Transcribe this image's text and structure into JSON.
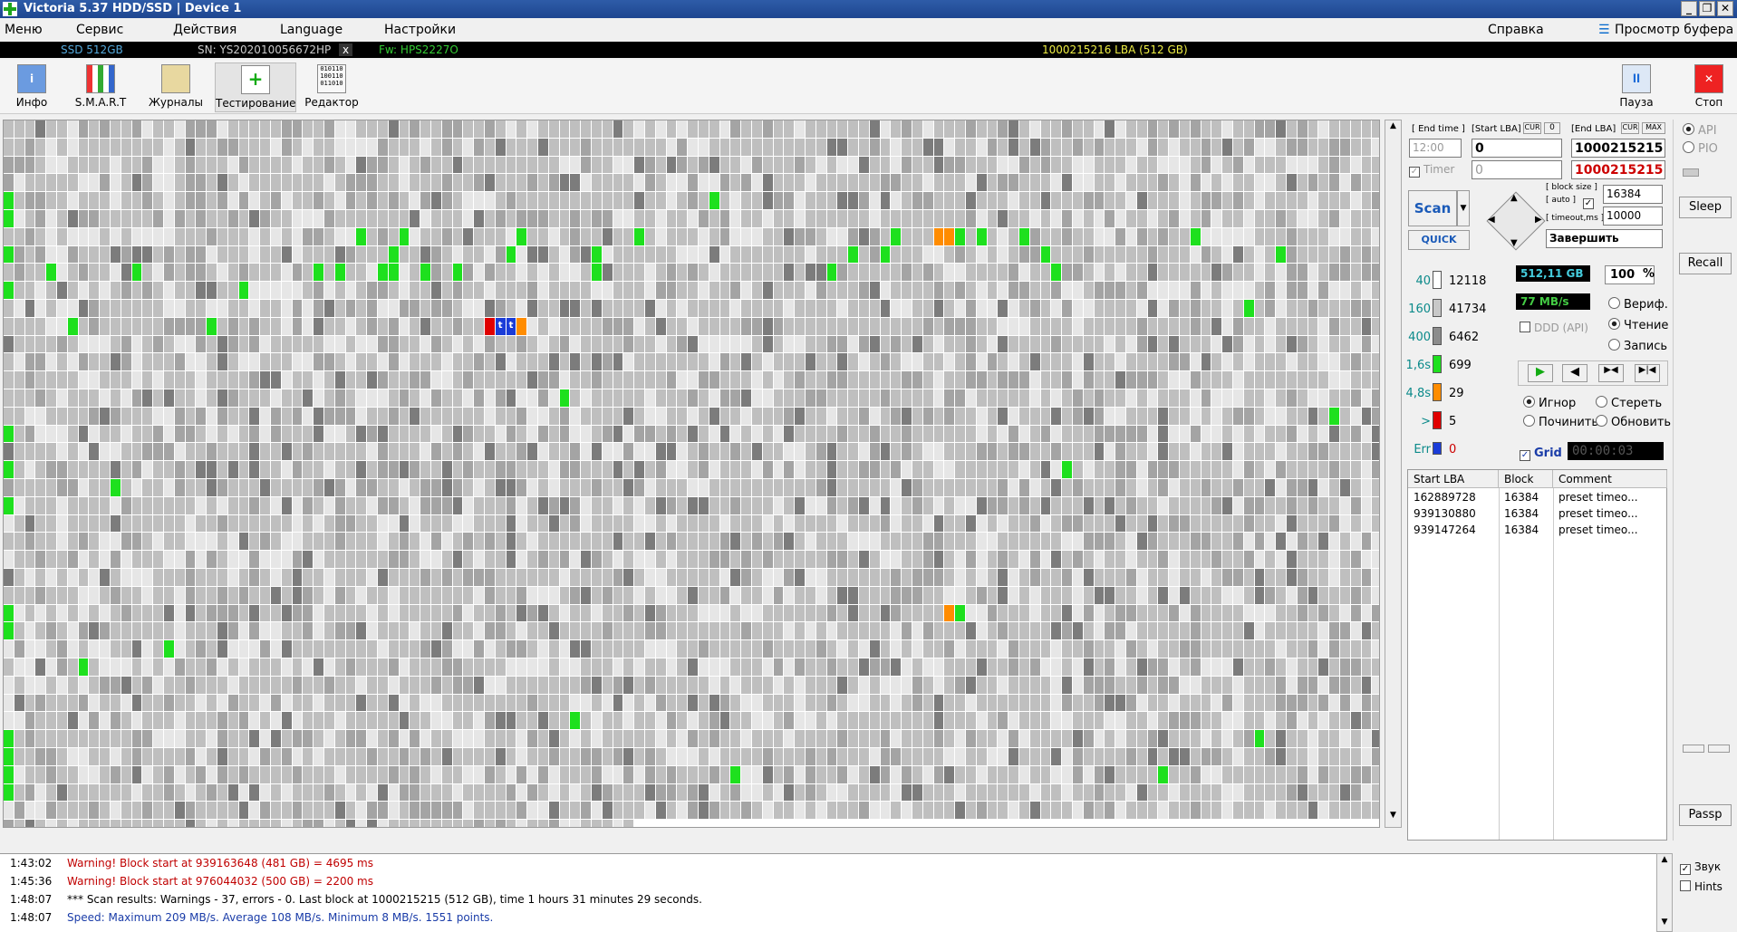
{
  "window": {
    "title": "Victoria 5.37 HDD/SSD | Device 1",
    "min": "_",
    "max": "❐",
    "close": "✕"
  },
  "menu": {
    "items": [
      "Меню",
      "Сервис",
      "Действия",
      "Language",
      "Настройки"
    ],
    "help": "Справка",
    "buffer": "Просмотр буфера"
  },
  "info": {
    "model": "SSD 512GB",
    "sn": "SN: YS202010056672HP",
    "x": "x",
    "fw": "Fw: HPS2227O",
    "lba": "1000215216 LBA (512 GB)"
  },
  "toolbar": {
    "info": "Инфо",
    "smart": "S.M.A.R.T",
    "logs": "Журналы",
    "test": "Тестирование",
    "editor": "Редактор",
    "pause": "Пауза",
    "stop": "Стоп"
  },
  "grid": {
    "rows": 40,
    "cols": 129,
    "last_row_filled": 59,
    "highlights": [
      {
        "r": 4,
        "c": 0,
        "k": "g"
      },
      {
        "r": 4,
        "c": 66,
        "k": "g"
      },
      {
        "r": 5,
        "c": 0,
        "k": "g"
      },
      {
        "r": 6,
        "c": 33,
        "k": "g"
      },
      {
        "r": 6,
        "c": 37,
        "k": "g"
      },
      {
        "r": 6,
        "c": 48,
        "k": "g"
      },
      {
        "r": 6,
        "c": 59,
        "k": "g"
      },
      {
        "r": 6,
        "c": 83,
        "k": "g"
      },
      {
        "r": 6,
        "c": 87,
        "k": "o"
      },
      {
        "r": 6,
        "c": 88,
        "k": "o"
      },
      {
        "r": 6,
        "c": 89,
        "k": "g"
      },
      {
        "r": 6,
        "c": 91,
        "k": "g"
      },
      {
        "r": 6,
        "c": 95,
        "k": "g"
      },
      {
        "r": 6,
        "c": 111,
        "k": "g"
      },
      {
        "r": 7,
        "c": 0,
        "k": "g"
      },
      {
        "r": 7,
        "c": 36,
        "k": "g"
      },
      {
        "r": 7,
        "c": 47,
        "k": "g"
      },
      {
        "r": 7,
        "c": 55,
        "k": "g"
      },
      {
        "r": 7,
        "c": 79,
        "k": "g"
      },
      {
        "r": 7,
        "c": 82,
        "k": "g"
      },
      {
        "r": 7,
        "c": 97,
        "k": "g"
      },
      {
        "r": 7,
        "c": 119,
        "k": "g"
      },
      {
        "r": 8,
        "c": 4,
        "k": "g"
      },
      {
        "r": 8,
        "c": 12,
        "k": "g"
      },
      {
        "r": 8,
        "c": 29,
        "k": "g"
      },
      {
        "r": 8,
        "c": 31,
        "k": "g"
      },
      {
        "r": 8,
        "c": 35,
        "k": "g"
      },
      {
        "r": 8,
        "c": 36,
        "k": "g"
      },
      {
        "r": 8,
        "c": 39,
        "k": "g"
      },
      {
        "r": 8,
        "c": 42,
        "k": "g"
      },
      {
        "r": 8,
        "c": 55,
        "k": "g"
      },
      {
        "r": 8,
        "c": 77,
        "k": "g"
      },
      {
        "r": 8,
        "c": 98,
        "k": "g"
      },
      {
        "r": 9,
        "c": 0,
        "k": "g"
      },
      {
        "r": 9,
        "c": 22,
        "k": "g"
      },
      {
        "r": 10,
        "c": 116,
        "k": "g"
      },
      {
        "r": 11,
        "c": 6,
        "k": "g"
      },
      {
        "r": 11,
        "c": 19,
        "k": "g"
      },
      {
        "r": 11,
        "c": 45,
        "k": "r"
      },
      {
        "r": 11,
        "c": 46,
        "k": "b"
      },
      {
        "r": 11,
        "c": 47,
        "k": "b"
      },
      {
        "r": 11,
        "c": 48,
        "k": "o"
      },
      {
        "r": 15,
        "c": 52,
        "k": "g"
      },
      {
        "r": 16,
        "c": 124,
        "k": "g"
      },
      {
        "r": 17,
        "c": 0,
        "k": "g"
      },
      {
        "r": 19,
        "c": 0,
        "k": "g"
      },
      {
        "r": 19,
        "c": 99,
        "k": "g"
      },
      {
        "r": 20,
        "c": 10,
        "k": "g"
      },
      {
        "r": 21,
        "c": 0,
        "k": "g"
      },
      {
        "r": 27,
        "c": 0,
        "k": "g"
      },
      {
        "r": 27,
        "c": 88,
        "k": "o"
      },
      {
        "r": 27,
        "c": 89,
        "k": "g"
      },
      {
        "r": 28,
        "c": 0,
        "k": "g"
      },
      {
        "r": 29,
        "c": 15,
        "k": "g"
      },
      {
        "r": 30,
        "c": 7,
        "k": "g"
      },
      {
        "r": 33,
        "c": 53,
        "k": "g"
      },
      {
        "r": 34,
        "c": 0,
        "k": "g"
      },
      {
        "r": 34,
        "c": 117,
        "k": "g"
      },
      {
        "r": 35,
        "c": 0,
        "k": "g"
      },
      {
        "r": 36,
        "c": 0,
        "k": "g"
      },
      {
        "r": 36,
        "c": 68,
        "k": "g"
      },
      {
        "r": 36,
        "c": 108,
        "k": "g"
      },
      {
        "r": 37,
        "c": 0,
        "k": "g"
      }
    ]
  },
  "controls": {
    "end_time_label": "[ End time ]",
    "start_lba_label": "[Start LBA]",
    "cur": "CUR",
    "zero": "0",
    "end_lba_label": "[End LBA]",
    "cur2": "CUR",
    "max": "MAX",
    "time": "12:00",
    "start_lba": "0",
    "end_lba": "1000215215",
    "timer": "Timer",
    "timer_val": "0",
    "end_lba2": "1000215215",
    "scan": "Scan",
    "quick": "QUICK",
    "block_size_label": "[ block size ]",
    "auto_label": "[ auto ]",
    "timeout_label": "[ timeout,ms ]",
    "block_size": "16384",
    "timeout": "10000",
    "finish": "Завершить"
  },
  "legend": [
    {
      "k": "40",
      "v": "12118",
      "c": "#ffffff"
    },
    {
      "k": "160",
      "v": "41734",
      "c": "#c8c8c8"
    },
    {
      "k": "400",
      "v": "6462",
      "c": "#8c8c8c"
    },
    {
      "k": "1,6s",
      "v": "699",
      "c": "#1ee01e"
    },
    {
      "k": "4,8s",
      "v": "29",
      "c": "#ff8c00"
    },
    {
      "k": ">",
      "v": "5",
      "c": "#e00000"
    },
    {
      "k": "Err",
      "v": "0",
      "c": "#1a3cd8"
    }
  ],
  "stats": {
    "size": "512,11 GB",
    "pct": "100",
    "pct_unit": "%",
    "speed": "77 MB/s",
    "ddd": "DDD (API)",
    "verify": "Вериф.",
    "read": "Чтение",
    "write": "Запись",
    "ignore": "Игнор",
    "erase": "Стереть",
    "repair": "Починить",
    "refresh": "Обновить",
    "grid": "Grid",
    "elapsed": "00:00:03"
  },
  "table": {
    "headers": [
      "Start LBA",
      "Block",
      "Comment"
    ],
    "rows": [
      [
        "162889728",
        "16384",
        "preset timeo..."
      ],
      [
        "939130880",
        "16384",
        "preset timeo..."
      ],
      [
        "939147264",
        "16384",
        "preset timeo..."
      ]
    ]
  },
  "side": {
    "api": "API",
    "pio": "PIO",
    "sleep": "Sleep",
    "recall": "Recall",
    "passp": "Passp"
  },
  "log": [
    {
      "t": "1:43:02",
      "m": "Warning! Block start at 939163648 (481 GB)  = 4695 ms",
      "c": "#c00000"
    },
    {
      "t": "1:45:36",
      "m": "Warning! Block start at 976044032 (500 GB)  = 2200 ms",
      "c": "#c00000"
    },
    {
      "t": "1:48:07",
      "m": "*** Scan results: Warnings - 37, errors - 0. Last block at 1000215215 (512 GB), time 1 hours 31 minutes 29 seconds.",
      "c": "#000000"
    },
    {
      "t": "1:48:07",
      "m": "Speed: Maximum 209 MB/s. Average 108 MB/s. Minimum 8 MB/s. 1551 points.",
      "c": "#1a3ca8"
    }
  ],
  "logside": {
    "sound": "Звук",
    "hints": "Hints"
  }
}
